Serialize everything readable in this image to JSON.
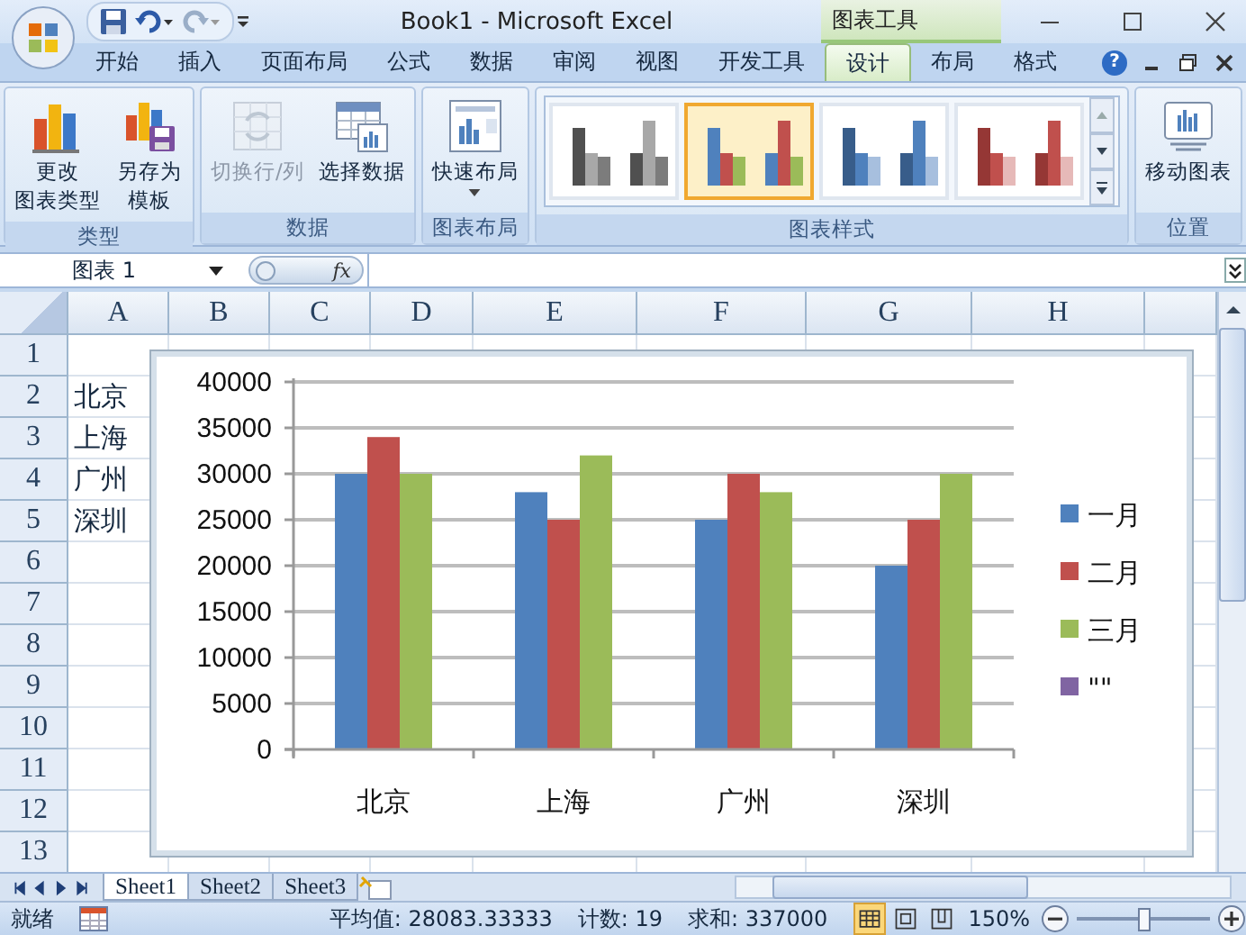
{
  "title_bar": {
    "title": "Book1 - Microsoft Excel",
    "context_label": "图表工具"
  },
  "ribbon_tabs": [
    {
      "label": "开始",
      "selected": false
    },
    {
      "label": "插入",
      "selected": false
    },
    {
      "label": "页面布局",
      "selected": false
    },
    {
      "label": "公式",
      "selected": false
    },
    {
      "label": "数据",
      "selected": false
    },
    {
      "label": "审阅",
      "selected": false
    },
    {
      "label": "视图",
      "selected": false
    },
    {
      "label": "开发工具",
      "selected": false
    },
    {
      "label": "设计",
      "selected": true
    },
    {
      "label": "布局",
      "selected": false
    },
    {
      "label": "格式",
      "selected": false
    }
  ],
  "help_label": "?",
  "ribbon_groups": [
    {
      "label": "类型",
      "buttons": [
        {
          "lines": [
            "更改",
            "图表类型"
          ],
          "disabled": false
        },
        {
          "lines": [
            "另存为",
            "模板"
          ],
          "disabled": false
        }
      ]
    },
    {
      "label": "数据",
      "buttons": [
        {
          "lines": [
            "切换行/列"
          ],
          "disabled": true
        },
        {
          "lines": [
            "选择数据"
          ],
          "disabled": false
        }
      ]
    },
    {
      "label": "图表布局",
      "buttons": [
        {
          "lines": [
            "快速布局"
          ],
          "disabled": false,
          "dropdown": true
        }
      ]
    },
    {
      "label": "图表样式",
      "styles": [
        {
          "kind": "gray",
          "selected": false
        },
        {
          "kind": "mixed",
          "selected": true
        },
        {
          "kind": "blue",
          "selected": false
        },
        {
          "kind": "red",
          "selected": false
        }
      ]
    },
    {
      "label": "位置",
      "buttons": [
        {
          "lines": [
            "移动图表"
          ],
          "disabled": false
        }
      ]
    }
  ],
  "formula_bar": {
    "name_box": "图表 1",
    "function_label": "fx"
  },
  "sheet": {
    "columns": [
      "A",
      "B",
      "C",
      "D",
      "E",
      "F",
      "G",
      "H"
    ],
    "rows": [
      {
        "number": "1",
        "cells": []
      },
      {
        "number": "2",
        "cells": [
          "北京"
        ]
      },
      {
        "number": "3",
        "cells": [
          "上海"
        ]
      },
      {
        "number": "4",
        "cells": [
          "广州"
        ]
      },
      {
        "number": "5",
        "cells": [
          "深圳"
        ]
      },
      {
        "number": "6",
        "cells": []
      },
      {
        "number": "7",
        "cells": []
      },
      {
        "number": "8",
        "cells": []
      },
      {
        "number": "9",
        "cells": []
      },
      {
        "number": "10",
        "cells": []
      },
      {
        "number": "11",
        "cells": []
      },
      {
        "number": "12",
        "cells": []
      },
      {
        "number": "13",
        "cells": []
      }
    ]
  },
  "chart": {
    "chart_data": {
      "type": "bar",
      "categories": [
        "北京",
        "上海",
        "广州",
        "深圳"
      ],
      "series": [
        {
          "name": "一月",
          "color": "#4f81bd",
          "values": [
            30000,
            28000,
            25000,
            20000
          ]
        },
        {
          "name": "二月",
          "color": "#c0504d",
          "values": [
            34000,
            25000,
            30000,
            25000
          ]
        },
        {
          "name": "三月",
          "color": "#9bbb59",
          "values": [
            30000,
            32000,
            28000,
            30000
          ]
        },
        {
          "name": "\"\"",
          "color": "#8064a2",
          "values": [
            null,
            null,
            null,
            null
          ]
        }
      ],
      "grid": true,
      "legend": true,
      "ylim": [
        0,
        40000
      ],
      "yticks": [
        0,
        5000,
        10000,
        15000,
        20000,
        25000,
        30000,
        35000,
        40000
      ]
    }
  },
  "sheet_tabs": [
    {
      "label": "Sheet1",
      "selected": true
    },
    {
      "label": "Sheet2",
      "selected": false
    },
    {
      "label": "Sheet3",
      "selected": false
    }
  ],
  "status_bar": {
    "mode": "就绪",
    "average": "平均值: 28083.33333",
    "count": "计数: 19",
    "sum": "求和: 337000",
    "views": [
      {
        "selected": true
      },
      {
        "selected": false
      },
      {
        "selected": false
      }
    ],
    "zoom": "150%",
    "zoom_slider": {
      "level": 0.5
    }
  }
}
